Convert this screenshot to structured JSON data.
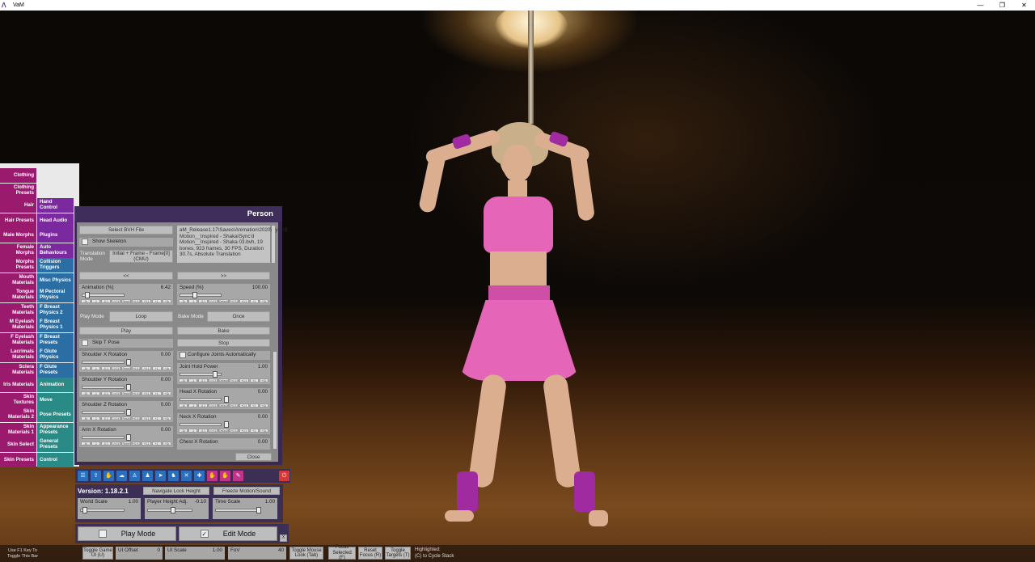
{
  "window": {
    "title": "VaM",
    "controls": [
      "—",
      "❐",
      "✕"
    ]
  },
  "tabs_left": [
    {
      "label": "Clothing"
    },
    {
      "label": "Clothing Presets"
    },
    {
      "label": "Hair"
    },
    {
      "label": "Hair Presets"
    },
    {
      "label": "Male Morphs"
    },
    {
      "label": "Female Morphs"
    },
    {
      "label": "Morphs Presets"
    },
    {
      "label": "Mouth Materials"
    },
    {
      "label": "Tongue Materials"
    },
    {
      "label": "Teeth Materials"
    },
    {
      "label": "M Eyelash Materials"
    },
    {
      "label": "F Eyelash Materials"
    },
    {
      "label": "Lacrimals Materials"
    },
    {
      "label": "Sclera Materials"
    },
    {
      "label": "Iris Materials"
    },
    {
      "label": "Skin Textures"
    },
    {
      "label": "Skin Materials 2"
    },
    {
      "label": "Skin Materials 1"
    },
    {
      "label": "Skin Select"
    },
    {
      "label": "Skin Presets"
    }
  ],
  "tabs_right": [
    {
      "label": "Hand Control"
    },
    {
      "label": "Head Audio"
    },
    {
      "label": "Plugins"
    },
    {
      "label": "Auto Behaviours"
    },
    {
      "label": "Collision Triggers"
    },
    {
      "label": "Misc Physics"
    },
    {
      "label": "M Pectoral Physics"
    },
    {
      "label": "F Breast Physics 2"
    },
    {
      "label": "F Breast Physics 1"
    },
    {
      "label": "F Breast Presets"
    },
    {
      "label": "F Glute Physics"
    },
    {
      "label": "F Glute Presets"
    },
    {
      "label": "Animation"
    },
    {
      "label": "Move"
    },
    {
      "label": "Pose Presets"
    },
    {
      "label": "Appearance Presets"
    },
    {
      "label": "General Presets"
    },
    {
      "label": "Control"
    }
  ],
  "person_panel": {
    "title": "Person",
    "select_bvh": "Select BVH File",
    "show_skeleton": "Show Skeleton",
    "translation_mode_label": "Translation Mode",
    "translation_mode_value": "Initial + Frame - Frame[0] (CMU)",
    "info_text": "aM_Release1.17\\Saves\\Animation\\2020\\Sync'd Motion__Inspired - Shaka\\Sync'd Motion__Inspired - Shaka 03.bvh, 19 bones, 923 frames, 30 FPS, Duration 30.7s, Absolute Translation",
    "prev": "<<",
    "next": ">>",
    "animation": {
      "name": "Animation (%)",
      "value": "6.42",
      "level": 0.064
    },
    "speed": {
      "name": "Speed (%)",
      "value": "100.00",
      "level": 0.35
    },
    "play_mode_label": "Play Mode",
    "play_mode_value": "Loop",
    "bake_mode_label": "Bake Mode",
    "bake_mode_value": "Once",
    "play": "Play",
    "bake": "Bake",
    "skip_t_pose": "Skip T Pose",
    "stop": "Stop",
    "configure_joints": "Configure Joints Automatically",
    "left_sliders": [
      {
        "name": "Shoulder X Rotation",
        "value": "0.00"
      },
      {
        "name": "Shoulder Y Rotation",
        "value": "0.00"
      },
      {
        "name": "Shoulder Z Rotation",
        "value": "0.00"
      },
      {
        "name": "Arm X Rotation",
        "value": "0.00"
      }
    ],
    "right_sliders": [
      {
        "name": "Joint Hold Power",
        "value": "1.00"
      },
      {
        "name": "Head X Rotation",
        "value": "0.00"
      },
      {
        "name": "Neck X Rotation",
        "value": "0.00"
      },
      {
        "name": "Chest X Rotation",
        "value": "0.00"
      }
    ],
    "ticks_small": [
      "-1k",
      "-1",
      "-0.1",
      "-0.01",
      "Reset",
      "+0.01",
      "+0.1",
      "+1",
      "+1k"
    ],
    "ticks_speed": [
      "-1k",
      "-1",
      "-0.1",
      "-0.01",
      "Default",
      "+0.01",
      "+0.1",
      "+1",
      "+1k"
    ],
    "close": "Close"
  },
  "toolbar": {
    "icons": [
      "menu-icon",
      "load-icon",
      "hand-icon",
      "cloud-icon",
      "person-add-icon",
      "person-icon",
      "pointer-icon",
      "person-alt-icon",
      "tools-icon",
      "plus-icon",
      "hand-red-icon",
      "hand-red-alt-icon",
      "wrench-red-icon"
    ],
    "power": "⏻"
  },
  "bottom_panel": {
    "version": "Version: 1.18.2.1",
    "navigate_lock": "Navigate Lock Height",
    "freeze": "Freeze Motion/Sound",
    "world_scale": {
      "name": "World Scale",
      "value": "1.00"
    },
    "player_height": {
      "name": "Player Height Adj.",
      "value": "-0.10"
    },
    "time_scale": {
      "name": "Time Scale",
      "value": "1.00"
    }
  },
  "modes": {
    "play": "Play Mode",
    "edit": "Edit Mode",
    "close_x": "X"
  },
  "bottom_bar": {
    "hint": "Use F1 Key To Toggle This Bar",
    "toggle_game_ui": "Toggle Game UI (U)",
    "ui_offset": {
      "name": "UI Offset",
      "value": "0"
    },
    "ui_scale": {
      "name": "UI Scale",
      "value": "1.00"
    },
    "fov": {
      "name": "FoV",
      "value": "40"
    },
    "toggle_mouse_look": "Toggle Mouse Look (Tab)",
    "focus_selected": "Focus Selected (F)",
    "reset_focus": "Reset Focus (R)",
    "toggle_targets": "Toggle Targets (T)",
    "highlighted": "Highlighted:",
    "cycle_stack": "(C) to Cycle Stack"
  },
  "colors": {
    "tab_pink": "#9a1a6e",
    "tab_purple": "#7a2a9e",
    "tab_blue": "#2a6ea4",
    "tab_teal": "#2a8a86",
    "panel_header": "#3f2d5c",
    "toolbar_blue": "#2e6fbd"
  }
}
